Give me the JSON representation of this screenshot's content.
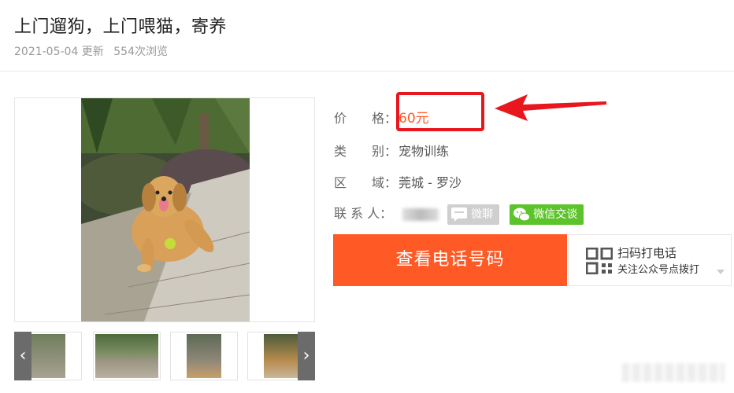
{
  "header": {
    "title": "上门遛狗，上门喂猫，寄养",
    "date": "2021-05-04 更新",
    "views": "554次浏览"
  },
  "info": {
    "price_label": "价　　格：",
    "price_value": "60元",
    "category_label": "类　　别：",
    "category_value": "宠物训练",
    "area_label": "区　　域：",
    "area_value": "莞城 -  罗沙",
    "contact_label": "联 系 人：",
    "weiliao_label": "微聊",
    "weixin_label": "微信交谈"
  },
  "actions": {
    "call_label": "查看电话号码",
    "scan_title": "扫码打电话",
    "scan_subtitle": "关注公众号点拨打"
  },
  "colors": {
    "accent": "#ff5a26",
    "price": "#ff5722",
    "highlight": "#e8171d",
    "wechat_green": "#5cc42a"
  }
}
